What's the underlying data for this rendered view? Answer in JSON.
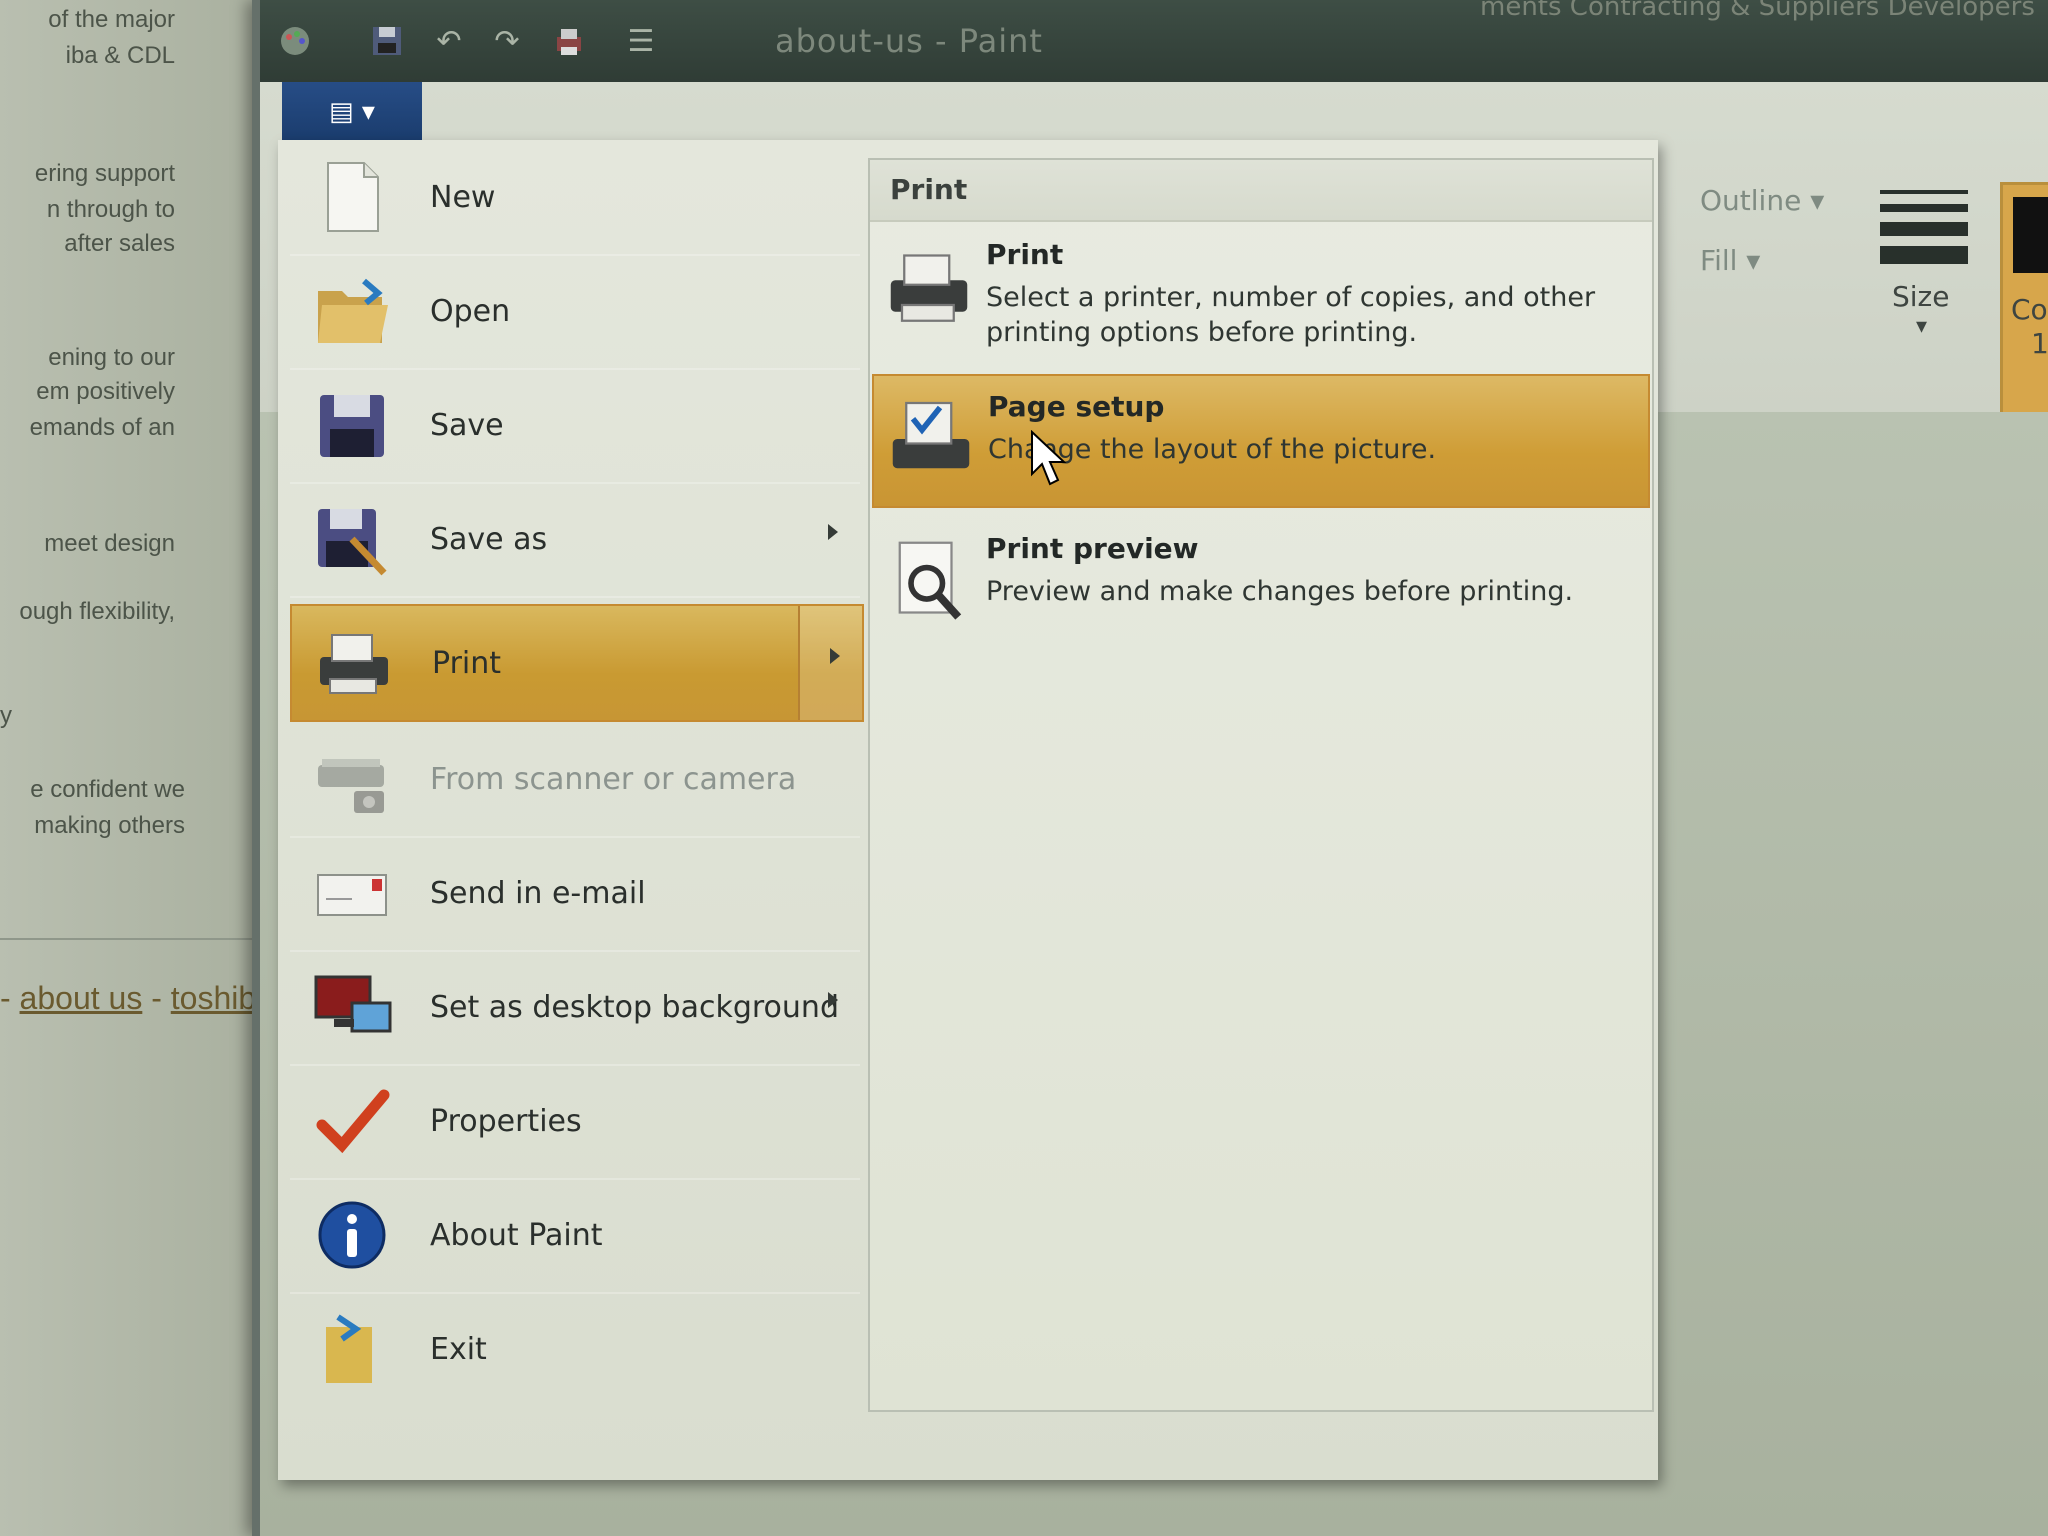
{
  "background_doc": {
    "lines": [
      "of the major",
      "iba & CDL",
      "ering support",
      "n through to",
      "after sales",
      "ening to our",
      "em positively",
      "emands of an",
      "meet design",
      "ough flexibility,",
      "y",
      "e confident we",
      "making others"
    ],
    "footer_prefix": "- ",
    "footer_link1": "about us",
    "footer_sep": " - ",
    "footer_link2": "toshib"
  },
  "window": {
    "title": "about-us - Paint",
    "title_right": "ments Contracting & Suppliers Developers",
    "quick_access": [
      "paint-icon",
      "save-icon",
      "undo-icon",
      "redo-icon",
      "printer-icon",
      "customize-icon"
    ]
  },
  "ribbon": {
    "file_tab_label": "▤ ▾",
    "outline_label": "Outline ▾",
    "fill_label": "Fill ▾",
    "size_label": "Size",
    "size_arrow": "▾",
    "color_label": "Col",
    "color_label2": "1"
  },
  "file_menu": {
    "items": [
      {
        "label": "New",
        "icon": "new-document-icon"
      },
      {
        "label": "Open",
        "icon": "open-folder-icon"
      },
      {
        "label": "Save",
        "icon": "floppy-disk-icon"
      },
      {
        "label": "Save as",
        "icon": "save-as-icon"
      },
      {
        "label": "Print",
        "icon": "printer-icon"
      },
      {
        "label": "From scanner or camera",
        "icon": "scanner-icon"
      },
      {
        "label": "Send in e-mail",
        "icon": "email-icon"
      },
      {
        "label": "Set as desktop background",
        "icon": "desktop-background-icon"
      },
      {
        "label": "Properties",
        "icon": "checkmark-icon"
      },
      {
        "label": "About Paint",
        "icon": "info-icon"
      },
      {
        "label": "Exit",
        "icon": "exit-icon"
      }
    ],
    "submenu": {
      "header": "Print",
      "items": [
        {
          "title": "Print",
          "description": "Select a printer, number of copies, and other printing options before printing.",
          "icon": "printer-icon"
        },
        {
          "title": "Page setup",
          "description": "Change the layout of the picture.",
          "icon": "page-setup-icon"
        },
        {
          "title": "Print preview",
          "description": "Preview and make changes before printing.",
          "icon": "print-preview-icon"
        }
      ]
    }
  },
  "colors": {
    "highlight": "#cf9d36",
    "file_tab": "#1a3c6d",
    "title_bar": "#2f3c35"
  }
}
